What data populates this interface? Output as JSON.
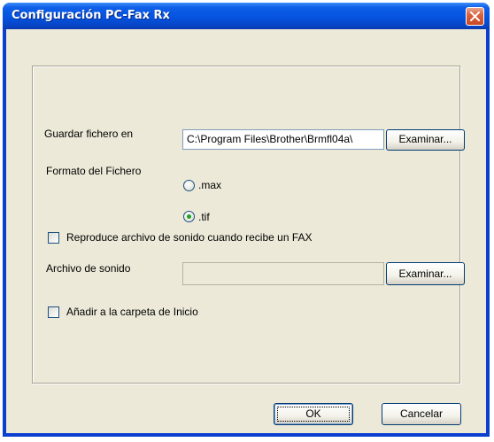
{
  "window": {
    "title": "Configuración PC-Fax Rx"
  },
  "save_to": {
    "label": "Guardar fichero en",
    "value": "C:\\Program Files\\Brother\\Brmfl04a\\",
    "browse_label": "Examinar..."
  },
  "file_format": {
    "label": "Formato del Fichero",
    "options": [
      {
        "label": ".max",
        "selected": false
      },
      {
        "label": ".tif",
        "selected": true
      }
    ]
  },
  "play_sound": {
    "label": "Reproduce archivo de sonido cuando recibe un FAX",
    "checked": false
  },
  "sound_file": {
    "label": "Archivo de sonido",
    "value": "",
    "browse_label": "Examinar..."
  },
  "startup": {
    "label": "Añadir a la carpeta de Inicio",
    "checked": false
  },
  "buttons": {
    "ok": "OK",
    "cancel": "Cancelar"
  },
  "colors": {
    "titlebar": "#0553df",
    "dialog_face": "#ece9d8",
    "radio_dot": "#21a121"
  }
}
